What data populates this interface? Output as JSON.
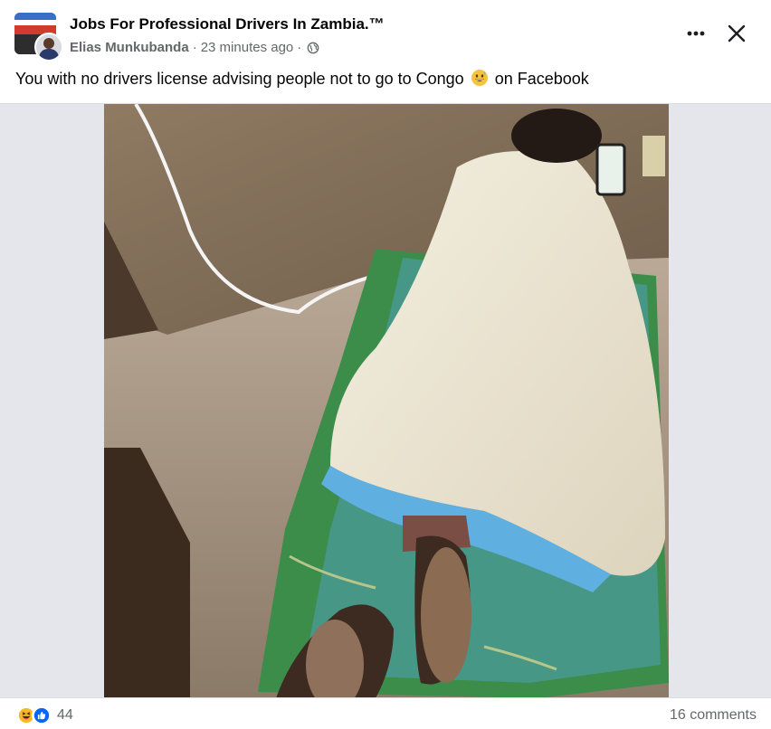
{
  "post": {
    "group_name": "Jobs For Professional Drivers In Zambia.™",
    "author": "Elias Munkubanda",
    "separator": "·",
    "time": "23 minutes ago",
    "privacy_icon": "globe-icon",
    "text_before_emoji": "You with no drivers license advising people not to go to Congo",
    "emoji": "grinning-sweat-emoji",
    "text_after_emoji": "on Facebook",
    "photo_description_icon": "photo"
  },
  "actions": {
    "more_icon": "ellipsis-icon",
    "close_icon": "close-icon"
  },
  "footer": {
    "reaction_icons": [
      "haha-icon",
      "like-icon"
    ],
    "reaction_count": "44",
    "comments_label": "16 comments"
  },
  "colors": {
    "text_primary": "#050505",
    "text_secondary": "#65676b",
    "like_blue": "#0866ff",
    "haha_yellow": "#f7b928",
    "divider": "#dadde1"
  }
}
